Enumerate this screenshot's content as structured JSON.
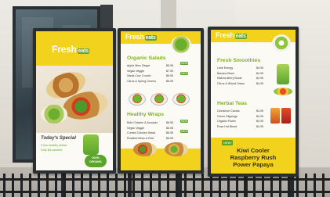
{
  "signs": {
    "left": {
      "logo": "Fresh",
      "logo_suffix": "eats",
      "special_title": "Today's Special",
      "special_line1": "3 low healthy drinks",
      "special_line2": "Only $4 calories",
      "badge_line1": "100%",
      "badge_line2": "ORGANIC"
    },
    "middle": {
      "logo": "Fresh",
      "logo_suffix": "eats",
      "salads_title": "Organic Salads",
      "salads": [
        {
          "name": "Apple Miso Ginger",
          "price": "$6.95"
        },
        {
          "name": "Vegan Veggie",
          "price": "$7.95"
        },
        {
          "name": "Santa Cruz Crunch",
          "price": "$6.95"
        },
        {
          "name": "Citrus & Spring Greens",
          "price": "$6.95"
        }
      ],
      "wraps_title": "Healthy Wraps",
      "wraps": [
        {
          "name": "Bold Chicken & Avocado",
          "price": "$6.95"
        },
        {
          "name": "Vegan Veggie",
          "price": "$6.95"
        },
        {
          "name": "Curried Chicken Salad",
          "price": "$6.95"
        },
        {
          "name": "Roasted Bean & Rice",
          "price": "$6.95"
        }
      ],
      "salad_badges": [
        "NEW",
        "NEW"
      ],
      "wrap_badges": [
        "NEW",
        "NEW"
      ]
    },
    "right": {
      "logo": "Fresh",
      "logo_suffix": "eats",
      "smoothies_title": "Fresh Smoothies",
      "smoothies": [
        {
          "name": "Lime Energy",
          "price": "$4.95"
        },
        {
          "name": "Banana Bean",
          "price": "$4.95"
        },
        {
          "name": "Matcha Berry Boost",
          "price": "$4.95"
        },
        {
          "name": "Citrus & Wheat Grass",
          "price": "$4.95"
        }
      ],
      "teas_title": "Herbal Teas",
      "teas": [
        {
          "name": "Cinnamon Cactus",
          "price": "$4.95"
        },
        {
          "name": "Green Clippings",
          "price": "$4.95"
        },
        {
          "name": "Organic Power",
          "price": "$4.95"
        },
        {
          "name": "Rose Hut Blend",
          "price": "$4.95"
        }
      ],
      "new_badge": "NEW!",
      "promo": [
        "Kiwi Cooler",
        "Raspberry Rush",
        "Power Papaya"
      ]
    }
  },
  "colors": {
    "brand_yellow": "#f2d21c",
    "brand_green": "#5aa52c",
    "frame": "#2b2e31"
  }
}
